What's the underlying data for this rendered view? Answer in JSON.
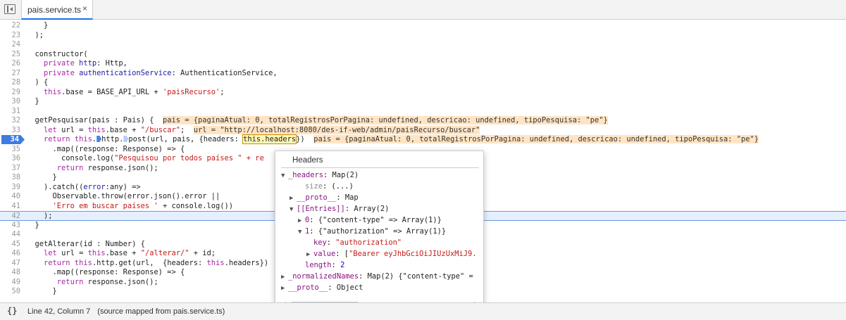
{
  "tab": {
    "label": "pais.service.ts",
    "close": "×"
  },
  "lines": [
    {
      "n": "22",
      "html": "    }"
    },
    {
      "n": "23",
      "html": "  );"
    },
    {
      "n": "24",
      "html": ""
    },
    {
      "n": "25",
      "html": "  constructor("
    },
    {
      "n": "26",
      "html": "    <span class='kw'>private</span> <span class='ty'>http</span>: Http,"
    },
    {
      "n": "27",
      "html": "    <span class='kw'>private</span> <span class='ty'>authenticationService</span>: AuthenticationService,"
    },
    {
      "n": "28",
      "html": "  ) {"
    },
    {
      "n": "29",
      "html": "    <span class='kw'>this</span>.base = BASE_API_URL + <span class='str'>'paisRecurso'</span>;"
    },
    {
      "n": "30",
      "html": "  }"
    },
    {
      "n": "31",
      "html": ""
    },
    {
      "n": "32",
      "html": "  getPesquisar(pais : Pais) {  <span class='inline'>pais = {paginaAtual: 0, totalRegistrosPorPagina: undefined, descricao: undefined, tipoPesquisa: \"pe\"}</span>"
    },
    {
      "n": "33",
      "html": "    <span class='kw'>let</span> url = <span class='kw'>this</span>.base + <span class='str'>\"/buscar\"</span>;  <span class='inline'>url = \"http://localhost:8080/des-if-web/admin/paisRecurso/buscar\"</span>"
    },
    {
      "n": "34",
      "html": "    <span class='kw'>return</span> <span class='kw'>this</span>.<span class='step'></span>http.<span class='step lt'></span>post(url, pais, {headers: <span class='hl'>this.headers</span>})  <span class='inline'>pais = {paginaAtual: 0, totalRegistrosPorPagina: undefined, descricao: undefined, tipoPesquisa: \"pe\"}</span>",
      "bp": true
    },
    {
      "n": "35",
      "html": "      .map((response: Response) => {"
    },
    {
      "n": "36",
      "html": "        console.log(<span class='str'>\"Pesquisou por todos países \" + re</span>"
    },
    {
      "n": "37",
      "html": "       <span class='kw'>return</span> response.json();"
    },
    {
      "n": "38",
      "html": "      }"
    },
    {
      "n": "39",
      "html": "    ).catch((<span class='ty'>error</span>:any) =>"
    },
    {
      "n": "40",
      "html": "      Observable.throw(error.json().error ||"
    },
    {
      "n": "41",
      "html": "      <span class='str'>'Erro em buscar países '</span> + console.log())"
    },
    {
      "n": "42",
      "html": "    );",
      "current": true
    },
    {
      "n": "43",
      "html": "  }"
    },
    {
      "n": "44",
      "html": ""
    },
    {
      "n": "45",
      "html": "  getAlterar(id : Number) {"
    },
    {
      "n": "46",
      "html": "    <span class='kw'>let</span> url = <span class='kw'>this</span>.base + <span class='str'>\"/alterar/\"</span> + id;"
    },
    {
      "n": "47",
      "html": "    <span class='kw'>return</span> <span class='kw'>this</span>.http.get(url,  {headers: <span class='kw'>this</span>.headers})"
    },
    {
      "n": "48",
      "html": "      .map((response: Response) => {"
    },
    {
      "n": "49",
      "html": "       <span class='kw'>return</span> response.json();"
    },
    {
      "n": "50",
      "html": "      }"
    }
  ],
  "popover": {
    "title": "Headers",
    "nodes": [
      {
        "indent": 0,
        "arrow": "▼",
        "html": "<span class='k'>_headers</span>: Map(2)"
      },
      {
        "indent": 2,
        "arrow": "",
        "html": "<span class='vd'>size</span>: (...)"
      },
      {
        "indent": 1,
        "arrow": "▶",
        "html": "<span class='k'>__proto__</span>: Map"
      },
      {
        "indent": 1,
        "arrow": "▼",
        "html": "<span class='k'>[[Entries]]</span>: Array(2)"
      },
      {
        "indent": 2,
        "arrow": "▶",
        "html": "<span class='k'>0</span>: {\"content-type\" => Array(1)}"
      },
      {
        "indent": 2,
        "arrow": "▼",
        "html": "<span class='k'>1</span>: {\"authorization\" => Array(1)}"
      },
      {
        "indent": 3,
        "arrow": "",
        "html": "<span class='k'>key</span>: <span class='v'>\"authorization\"</span>"
      },
      {
        "indent": 3,
        "arrow": "▶",
        "html": "<span class='k'>value</span>: [<span class='v'>\"Bearer eyJhbGciOiJIUzUxMiJ9.</span>"
      },
      {
        "indent": 2,
        "arrow": "",
        "html": "<span class='k'>length</span>: <span class='vn'>2</span>"
      },
      {
        "indent": 0,
        "arrow": "▶",
        "html": "<span class='k'>_normalizedNames</span>: Map(2) {\"content-type\" ="
      },
      {
        "indent": 0,
        "arrow": "▶",
        "html": "<span class='k'>__proto__</span>: Object"
      }
    ]
  },
  "status": {
    "icon": "{}",
    "position": "Line 42, Column 7",
    "source": "(source mapped from pais.service.ts)"
  }
}
